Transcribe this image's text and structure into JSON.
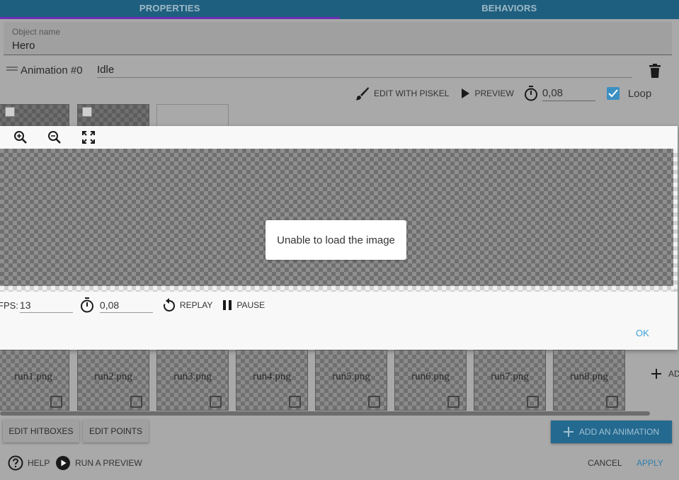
{
  "tabs": [
    {
      "label": "PROPERTIES",
      "active": true
    },
    {
      "label": "BEHAVIORS",
      "active": false
    }
  ],
  "object_name": {
    "label": "Object name",
    "value": "Hero"
  },
  "animation": {
    "label": "Animation #0",
    "name": "Idle"
  },
  "toolbar": {
    "edit_piskel": "EDIT WITH PISKEL",
    "preview": "PREVIEW",
    "duration": "0,08",
    "loop_label": "Loop",
    "loop_checked": true
  },
  "modal": {
    "error_message": "Unable to load the image",
    "fps_label": "FPS:",
    "fps_value": "13",
    "duration_value": "0,08",
    "replay": "REPLAY",
    "pause": "PAUSE",
    "ok": "OK"
  },
  "frames": [
    {
      "name": "run1.png"
    },
    {
      "name": "run2.png"
    },
    {
      "name": "run3.png"
    },
    {
      "name": "run4.png"
    },
    {
      "name": "run5.png"
    },
    {
      "name": "run6.png"
    },
    {
      "name": "run7.png"
    },
    {
      "name": "run8.png"
    }
  ],
  "add_frame_label": "AD",
  "buttons": {
    "edit_hitboxes": "EDIT HITBOXES",
    "edit_points": "EDIT POINTS",
    "add_animation": "ADD AN ANIMATION",
    "help": "HELP",
    "run_preview": "RUN A PREVIEW",
    "cancel": "CANCEL",
    "apply": "APPLY"
  },
  "colors": {
    "accent": "#3c9fd6",
    "tab_bar": "#1e5f7f",
    "tab_indicator": "#6b2fb3",
    "checkbox": "#3c8fc3"
  }
}
